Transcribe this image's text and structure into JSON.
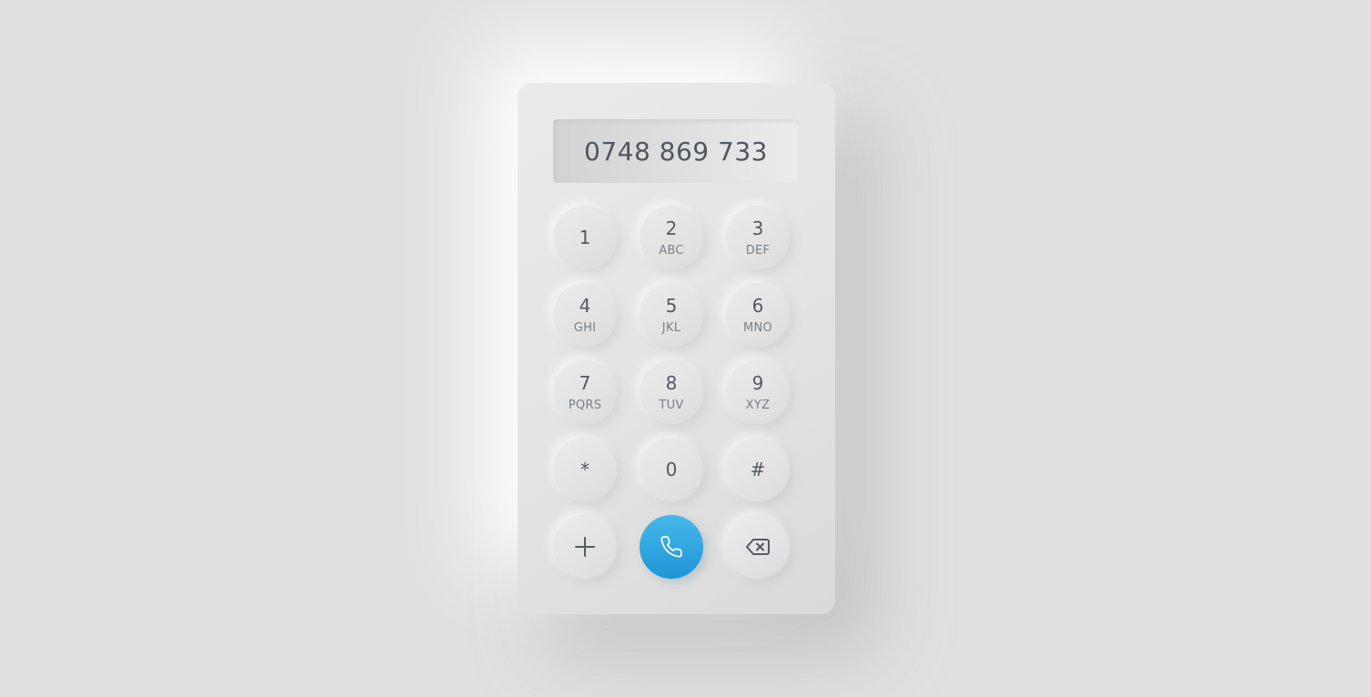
{
  "display": {
    "number": "0748 869 733"
  },
  "keypad": {
    "keys": [
      {
        "digit": "1",
        "letters": ""
      },
      {
        "digit": "2",
        "letters": "ABC"
      },
      {
        "digit": "3",
        "letters": "DEF"
      },
      {
        "digit": "4",
        "letters": "GHI"
      },
      {
        "digit": "5",
        "letters": "JKL"
      },
      {
        "digit": "6",
        "letters": "MNO"
      },
      {
        "digit": "7",
        "letters": "PQRS"
      },
      {
        "digit": "8",
        "letters": "TUV"
      },
      {
        "digit": "9",
        "letters": "XYZ"
      },
      {
        "digit": "*",
        "letters": ""
      },
      {
        "digit": "0",
        "letters": ""
      },
      {
        "digit": "#",
        "letters": ""
      }
    ]
  },
  "actions": {
    "add_icon": "plus-icon",
    "call_icon": "phone-icon",
    "backspace_icon": "backspace-icon"
  },
  "colors": {
    "background": "#e0e0e0",
    "call_accent": "#2aa6e2",
    "text": "#545b62"
  }
}
